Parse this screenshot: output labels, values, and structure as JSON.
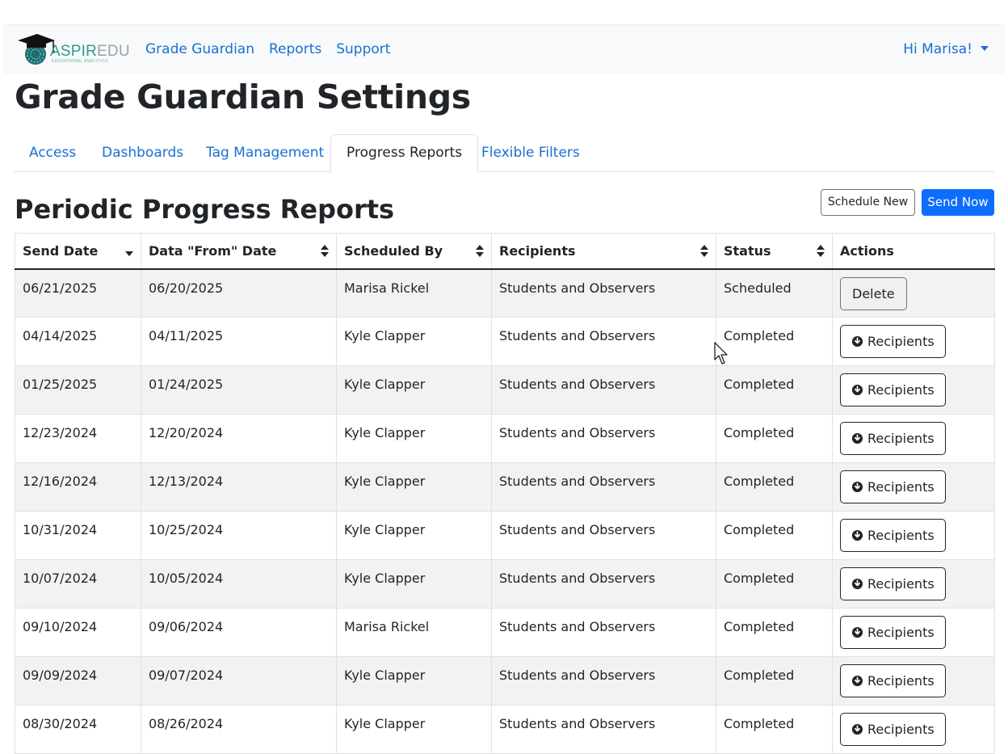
{
  "navbar": {
    "logo": {
      "text_part1": "ASPIR",
      "text_part2": "EDU",
      "tagline": "EDUCATIONAL ANALYTICS"
    },
    "links": [
      "Grade Guardian",
      "Reports",
      "Support"
    ],
    "user_greeting": "Hi Marisa!"
  },
  "page_title": "Grade Guardian Settings",
  "tabs": [
    {
      "label": "Access",
      "active": false
    },
    {
      "label": "Dashboards",
      "active": false
    },
    {
      "label": "Tag Management",
      "active": false
    },
    {
      "label": "Progress Reports",
      "active": true
    },
    {
      "label": "Flexible Filters",
      "active": false
    }
  ],
  "section": {
    "title": "Periodic Progress Reports",
    "schedule_new_label": "Schedule New",
    "send_now_label": "Send Now"
  },
  "table": {
    "columns": [
      "Send Date",
      "Data \"From\" Date",
      "Scheduled By",
      "Recipients",
      "Status",
      "Actions"
    ],
    "rows": [
      {
        "send_date": "06/21/2025",
        "from_date": "06/20/2025",
        "scheduled_by": "Marisa Rickel",
        "recipients": "Students and Observers",
        "status": "Scheduled",
        "action": "Delete"
      },
      {
        "send_date": "04/14/2025",
        "from_date": "04/11/2025",
        "scheduled_by": "Kyle Clapper",
        "recipients": "Students and Observers",
        "status": "Completed",
        "action": "Recipients"
      },
      {
        "send_date": "01/25/2025",
        "from_date": "01/24/2025",
        "scheduled_by": "Kyle Clapper",
        "recipients": "Students and Observers",
        "status": "Completed",
        "action": "Recipients"
      },
      {
        "send_date": "12/23/2024",
        "from_date": "12/20/2024",
        "scheduled_by": "Kyle Clapper",
        "recipients": "Students and Observers",
        "status": "Completed",
        "action": "Recipients"
      },
      {
        "send_date": "12/16/2024",
        "from_date": "12/13/2024",
        "scheduled_by": "Kyle Clapper",
        "recipients": "Students and Observers",
        "status": "Completed",
        "action": "Recipients"
      },
      {
        "send_date": "10/31/2024",
        "from_date": "10/25/2024",
        "scheduled_by": "Kyle Clapper",
        "recipients": "Students and Observers",
        "status": "Completed",
        "action": "Recipients"
      },
      {
        "send_date": "10/07/2024",
        "from_date": "10/05/2024",
        "scheduled_by": "Kyle Clapper",
        "recipients": "Students and Observers",
        "status": "Completed",
        "action": "Recipients"
      },
      {
        "send_date": "09/10/2024",
        "from_date": "09/06/2024",
        "scheduled_by": "Marisa Rickel",
        "recipients": "Students and Observers",
        "status": "Completed",
        "action": "Recipients"
      },
      {
        "send_date": "09/09/2024",
        "from_date": "09/07/2024",
        "scheduled_by": "Kyle Clapper",
        "recipients": "Students and Observers",
        "status": "Completed",
        "action": "Recipients"
      },
      {
        "send_date": "08/30/2024",
        "from_date": "08/26/2024",
        "scheduled_by": "Kyle Clapper",
        "recipients": "Students and Observers",
        "status": "Completed",
        "action": "Recipients"
      }
    ]
  },
  "colors": {
    "link": "#1a6fd3",
    "primary": "#0d6efd",
    "stripe": "#f2f2f2"
  }
}
